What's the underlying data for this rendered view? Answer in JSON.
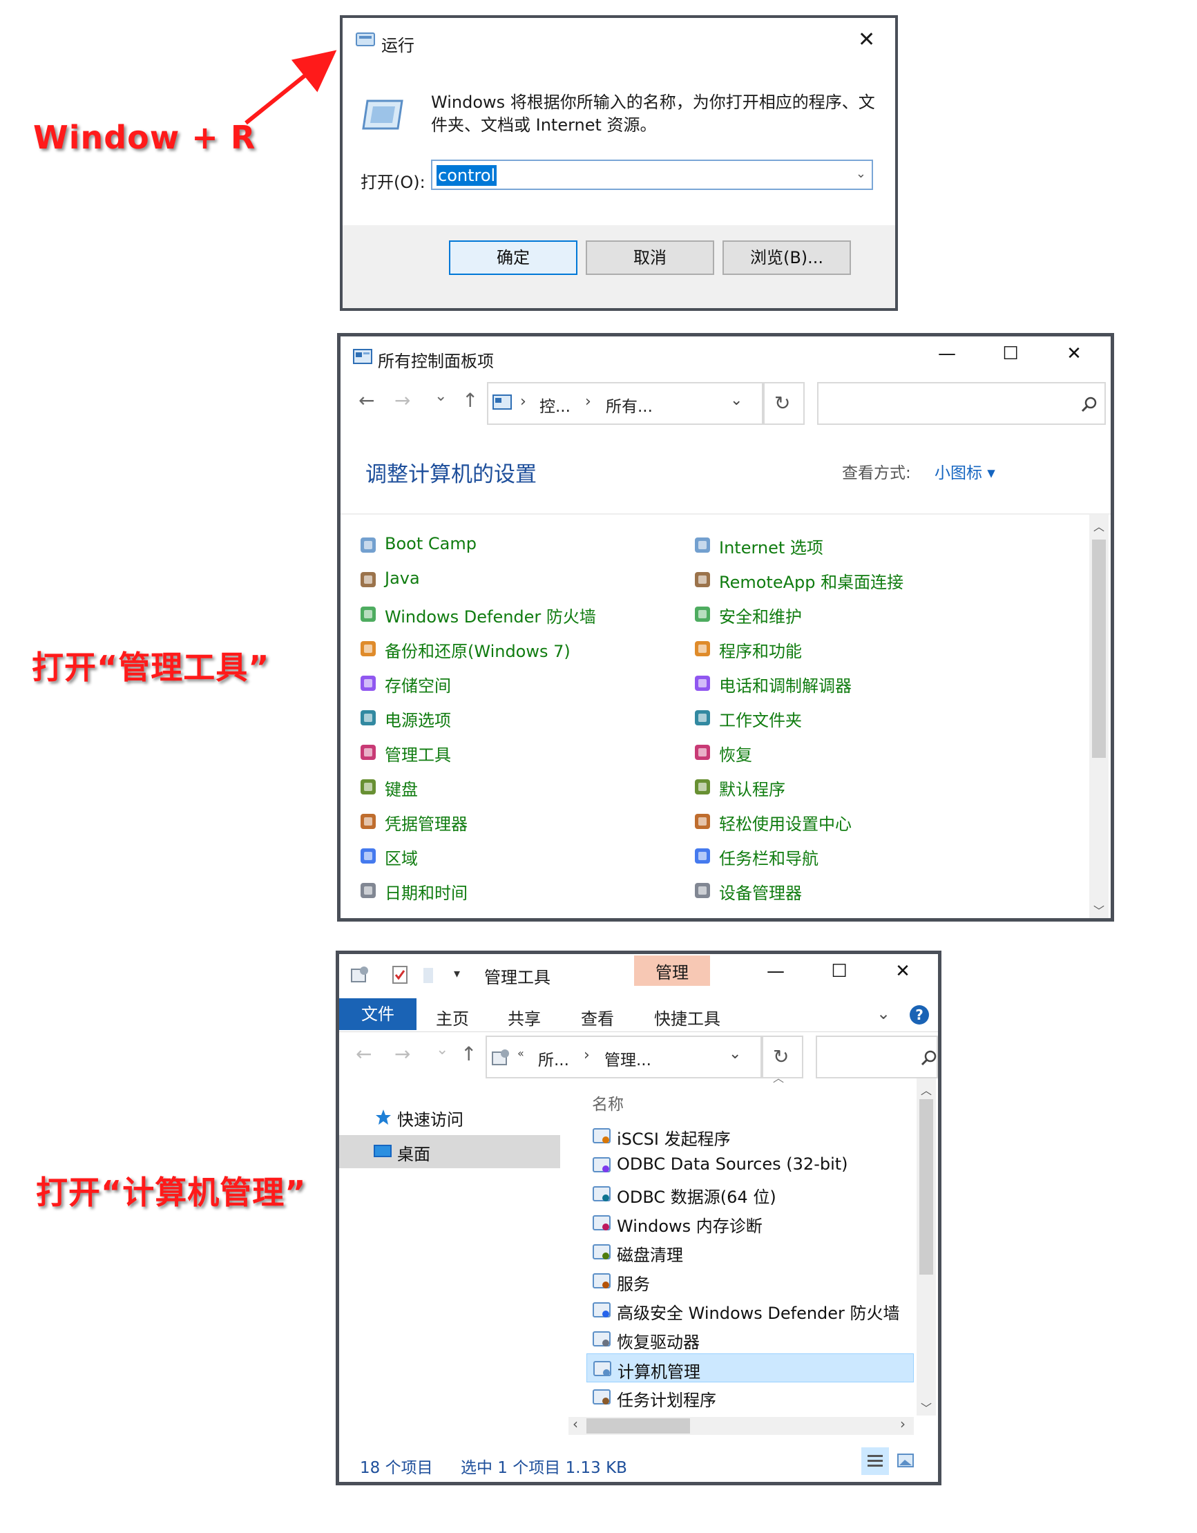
{
  "annotations": {
    "step1": "Window + R",
    "step2": "打开“管理工具”",
    "step3": "打开“计算机管理”"
  },
  "colors": {
    "annotation": "#ff1a1a",
    "cp_link": "#107c10",
    "accent": "#1a63b5",
    "contextual_tab": "#f7c8b4"
  },
  "run_dialog": {
    "title": "运行",
    "close": "✕",
    "description": "Windows 将根据你所输入的名称，为你打开相应的程序、文件夹、文档或 Internet 资源。",
    "open_label": "打开(O):",
    "input_value": "control",
    "ok_label": "确定",
    "cancel_label": "取消",
    "browse_label": "浏览(B)..."
  },
  "control_panel": {
    "title": "所有控制面板项",
    "minimize": "—",
    "maximize": "☐",
    "close": "✕",
    "nav": {
      "back": "←",
      "forward": "→",
      "recent": "⌄",
      "up": "↑",
      "refresh": "↻"
    },
    "breadcrumbs": [
      "控...",
      "所有..."
    ],
    "heading": "调整计算机的设置",
    "view_label": "查看方式:",
    "view_value": "小图标 ▾",
    "items_left": [
      "Boot Camp",
      "Java",
      "Windows Defender 防火墙",
      "备份和还原(Windows 7)",
      "存储空间",
      "电源选项",
      "管理工具",
      "键盘",
      "凭据管理器",
      "区域",
      "日期和时间"
    ],
    "items_right": [
      "Internet 选项",
      "RemoteApp 和桌面连接",
      "安全和维护",
      "程序和功能",
      "电话和调制解调器",
      "工作文件夹",
      "恢复",
      "默认程序",
      "轻松使用设置中心",
      "任务栏和导航",
      "设备管理器"
    ]
  },
  "admin_tools": {
    "title": "管理工具",
    "context_tab": "管理",
    "minimize": "—",
    "maximize": "☐",
    "close": "✕",
    "ribbon_tabs": [
      "文件",
      "主页",
      "共享",
      "查看",
      "快捷工具"
    ],
    "help": "?",
    "breadcrumbs": [
      "所...",
      "管理..."
    ],
    "nav_items": [
      "快速访问",
      "桌面"
    ],
    "column_header": "名称",
    "files": [
      "iSCSI 发起程序",
      "ODBC Data Sources (32-bit)",
      "ODBC 数据源(64 位)",
      "Windows 内存诊断",
      "磁盘清理",
      "服务",
      "高级安全 Windows Defender 防火墙",
      "恢复驱动器",
      "计算机管理",
      "任务计划程序"
    ],
    "selected_index": 8,
    "status_count": "18 个项目",
    "status_selected": "选中 1 个项目  1.13 KB"
  }
}
